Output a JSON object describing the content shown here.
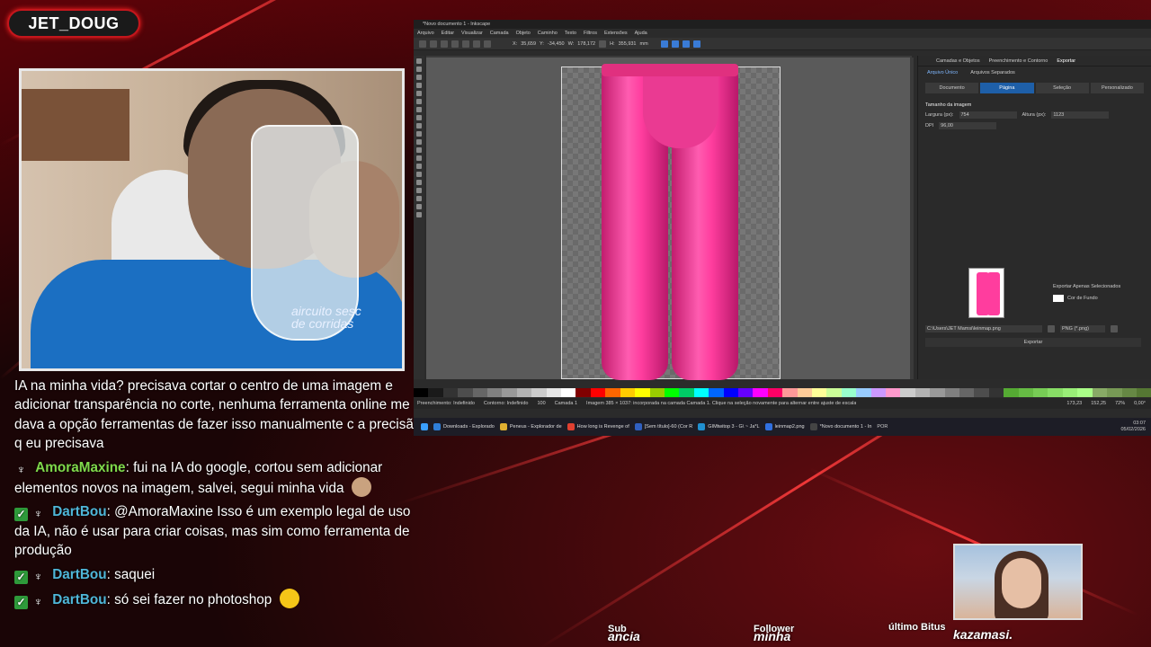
{
  "streamer": {
    "name": "JET_DOUG"
  },
  "webcam": {
    "shirt_text_line1": "aircuito sesc",
    "shirt_text_line2": "de corridas"
  },
  "chat": {
    "messages": [
      {
        "user": "",
        "text": "IA na minha vida? precisava cortar o centro de uma imagem e adicionar transparência no corte, nenhuma ferramenta online me dava a opção ferramentas de fazer isso manualmente c a precisão q eu precisava",
        "badges": [],
        "user_color": "#ffffff"
      },
      {
        "user": "AmoraMaxine",
        "text": "fui na IA do google, cortou sem adicionar elementos novos na imagem, salvei, segui minha vida",
        "badges": [
          "horns-icon"
        ],
        "user_color": "#7fd94b",
        "emoji": "face-emoji"
      },
      {
        "user": "DartBou",
        "text": "@AmoraMaxine Isso é um exemplo legal de uso da IA, não é usar para criar coisas, mas sim como ferramenta de produção",
        "badges": [
          "check-icon",
          "horns-icon"
        ],
        "user_color": "#4fb6d8"
      },
      {
        "user": "DartBou",
        "text": "saquei",
        "badges": [
          "check-icon",
          "horns-icon"
        ],
        "user_color": "#4fb6d8"
      },
      {
        "user": "DartBou",
        "text": "só sei fazer no photoshop",
        "badges": [
          "check-icon",
          "horns-icon"
        ],
        "user_color": "#4fb6d8",
        "emoji": "laughing-emoji"
      }
    ]
  },
  "inkscape": {
    "title": "*Novo documento 1 - Inkscape",
    "menu": [
      "Arquivo",
      "Editar",
      "Visualizar",
      "Camada",
      "Objeto",
      "Caminho",
      "Texto",
      "Filtros",
      "Extensões",
      "Ajuda"
    ],
    "coords": {
      "x": "35,659",
      "y": "-34,450",
      "w": "178,172",
      "h": "355,931",
      "unit": "mm"
    },
    "panel_tabs": [
      "Camadas e Objetos",
      "Preenchimento e Contorno",
      "Exportar"
    ],
    "export_modes": [
      "Arquivo Único",
      "Arquivos Separados"
    ],
    "export_areas": [
      "Documento",
      "Página",
      "Seleção",
      "Personalizado"
    ],
    "export_area_selected": "Página",
    "image_size_label": "Tamanho da imagem",
    "width_label": "Largura (px):",
    "width_value": "754",
    "height_label": "Altura (px):",
    "height_value": "1123",
    "dpi_label": "DPI",
    "dpi_value": "96,00",
    "export_selected_only": "Exportar Apenas Selecionados",
    "bg_color_label": "Cor de Fundo",
    "file_path": "C:\\Users\\JET Mamsi\\leinmap.png",
    "file_format": "PNG (*.png)",
    "export_button": "Exportar",
    "status": {
      "fill_label": "Preenchimento:",
      "fill": "Indefinido",
      "stroke_label": "Contorno:",
      "stroke": "Indefinido",
      "opacity": "100",
      "layer": "Camada 1",
      "message": "Imagem 385 × 1037: incorporada na camada Camada 1. Clique na seleção novamente para alternar entre ajuste de escala/rotação.",
      "zoom": "72%",
      "rotation": "0,00°",
      "cursor_x": "173,23",
      "cursor_y": "152,25"
    },
    "palette": [
      "#000000",
      "#1a1a1a",
      "#333333",
      "#4d4d4d",
      "#666666",
      "#808080",
      "#999999",
      "#b3b3b3",
      "#cccccc",
      "#e6e6e6",
      "#ffffff",
      "#800000",
      "#ff0000",
      "#ff6600",
      "#ffcc00",
      "#ffff00",
      "#99cc00",
      "#00ff00",
      "#00cc66",
      "#00ffff",
      "#0066ff",
      "#0000ff",
      "#6600ff",
      "#ff00ff",
      "#ff0066",
      "#ff9999",
      "#ffcc99",
      "#ffff99",
      "#ccff99",
      "#99ffcc",
      "#99ccff",
      "#cc99ff",
      "#ff99cc",
      "#cccccc",
      "#b3b3b3",
      "#999999",
      "#808080",
      "#666666",
      "#4d4d4d",
      "#333333",
      "#55aa33",
      "#66bb44",
      "#77cc55",
      "#88dd66",
      "#99ee77",
      "#aaff88",
      "#88aa66",
      "#779955",
      "#668844",
      "#557733"
    ]
  },
  "taskbar": {
    "items": [
      {
        "label": "Downloads - Explorado",
        "color": "#2f7fd8"
      },
      {
        "label": "Peneus - Explorador de",
        "color": "#e0b030"
      },
      {
        "label": "How long is Revenge of",
        "color": "#e04030"
      },
      {
        "label": "[Sem título]-60 (Cor R",
        "color": "#3060c0"
      },
      {
        "label": "GIMtwitop 3 - G\\ ~ Ja*L",
        "color": "#2090d0"
      },
      {
        "label": "leinmap2.png",
        "color": "#3070e0"
      },
      {
        "label": "*Novo documento 1 - In",
        "color": "#444444"
      }
    ],
    "lang": "POR",
    "time": "03:07",
    "date": "05/02/2026"
  },
  "bottom_bar": {
    "sub_label": "Sub",
    "sub_value": "ancia",
    "follower_label": "Follower",
    "follower_value": "minha",
    "bits_label": "último Bitus",
    "bits_value": "kazamasi."
  },
  "colors": {
    "accent": "#c4161c",
    "pink": "#ff3d9e",
    "check_badge": "#2e9a3a",
    "inkscape_active": "#1e5fa8"
  }
}
